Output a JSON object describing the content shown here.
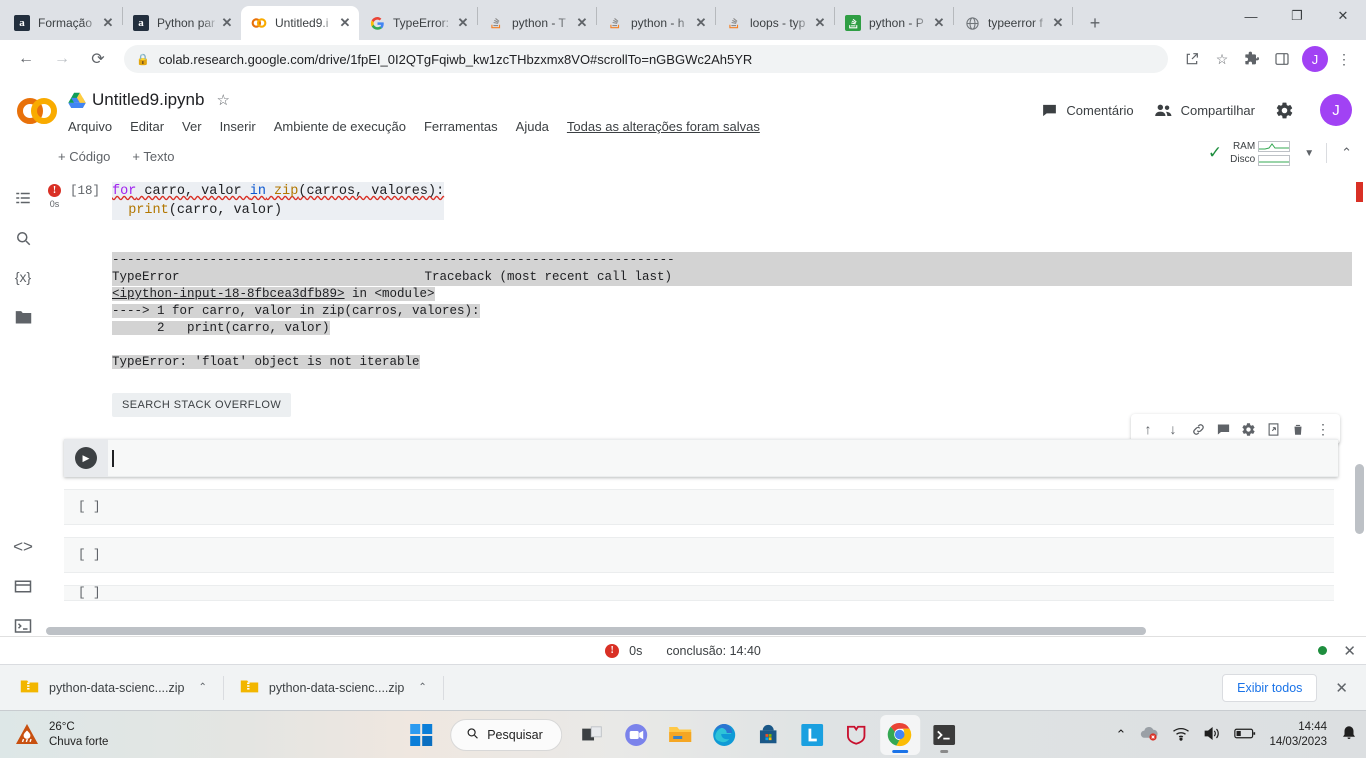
{
  "browser": {
    "tabs": [
      {
        "title": "Formação",
        "favicon": "amazon-icon",
        "active": false
      },
      {
        "title": "Python par",
        "favicon": "amazon-icon",
        "active": false
      },
      {
        "title": "Untitled9.i",
        "favicon": "colab-icon",
        "active": true
      },
      {
        "title": "TypeError:",
        "favicon": "google-icon",
        "active": false
      },
      {
        "title": "python - T",
        "favicon": "stackoverflow-icon",
        "active": false
      },
      {
        "title": "python - h",
        "favicon": "stackoverflow-icon",
        "active": false
      },
      {
        "title": "loops - typ",
        "favicon": "stackoverflow-icon",
        "active": false
      },
      {
        "title": "python - P",
        "favicon": "stackoverflow-green-icon",
        "active": false
      },
      {
        "title": "typeerror f",
        "favicon": "globe-icon",
        "active": false
      }
    ],
    "new_tab_label": "+",
    "window_controls": {
      "minimize": "—",
      "maximize": "❐",
      "close": "✕"
    },
    "nav": {
      "back": "←",
      "forward": "→",
      "reload": "⟳"
    },
    "url": "colab.research.google.com/drive/1fpEI_0I2QTgFqiwb_kw1zcTHbzxmx8VO#scrollTo=nGBGWc2Ah5YR",
    "lock_icon": "lock-icon",
    "toolbar_icons": [
      "share-icon",
      "star-icon",
      "extensions-icon",
      "sidepanel-icon",
      "menu-icon"
    ],
    "profile_initial": "J"
  },
  "colab": {
    "logo": "colab-logo",
    "notebook_title": "Untitled9.ipynb",
    "drive_icon": "drive-icon",
    "star_icon": "star-icon",
    "menu": [
      "Arquivo",
      "Editar",
      "Ver",
      "Inserir",
      "Ambiente de execução",
      "Ferramentas",
      "Ajuda"
    ],
    "save_status": "Todas as alterações foram salvas",
    "comment_label": "Comentário",
    "share_label": "Compartilhar",
    "settings_icon": "gear-icon",
    "avatar_initial": "J",
    "add_code_label": "+ Código",
    "add_text_label": "+ Texto",
    "resources": {
      "ram_label": "RAM",
      "disk_label": "Disco",
      "check_icon": "check-icon",
      "caret_icon": "chevron-down-icon",
      "collapse_icon": "chevron-up-icon"
    },
    "sidebar_icons": [
      "table-of-contents-icon",
      "search-icon",
      "variables-icon",
      "files-icon",
      "code-snippets-icon",
      "commands-icon",
      "terminal-icon"
    ],
    "cell": {
      "execution_count": "[18]",
      "error_badge": "!",
      "exec_time": "0s",
      "code_line_1": "for carro, valor in zip(carros, valores):",
      "code_line_2": "  print(carro, valor)",
      "code_tokens": {
        "kw_for": "for",
        "t_carro_valor": " carro, valor ",
        "kw_in": "in",
        "t_zip": " zip",
        "t_args": "(carros, valores):",
        "l2_indent": "  ",
        "l2_print": "print",
        "l2_args": "(carro, valor)"
      },
      "output": {
        "divider": "---------------------------------------------------------------------------",
        "err_name": "TypeError",
        "traceback_label": "Traceback (most recent call last)",
        "frame_file": "<ipython-input-18-8fbcea3dfb89>",
        "frame_in": " in <module>",
        "tb_line_1": "----> 1 for carro, valor in zip(carros, valores):",
        "tb_line_2": "      2   print(carro, valor)",
        "err_message": "TypeError: 'float' object is not iterable",
        "search_button": "SEARCH STACK OVERFLOW"
      }
    },
    "cell_toolbar_icons": [
      "move-up-icon",
      "move-down-icon",
      "link-icon",
      "comment-icon",
      "settings-icon",
      "open-in-new-icon",
      "delete-icon",
      "more-options-icon"
    ],
    "active_cell": {
      "run_icon": "run-icon",
      "value": "",
      "placeholder": ""
    },
    "empty_cells": [
      "[ ]",
      "[ ]",
      "[ ]"
    ],
    "status": {
      "error_badge": "!",
      "elapsed": "0s",
      "completion": "conclusão: 14:40",
      "connected_icon": "connected-dot",
      "close_icon": "close-icon"
    }
  },
  "downloads": {
    "items": [
      {
        "name": "python-data-scienc....zip",
        "icon": "zip-icon",
        "caret": "chevron-up-icon"
      },
      {
        "name": "python-data-scienc....zip",
        "icon": "zip-icon",
        "caret": "chevron-up-icon"
      }
    ],
    "show_all_label": "Exibir todos",
    "close_icon": "close-icon"
  },
  "taskbar": {
    "weather": {
      "temperature": "26°C",
      "condition": "Chuva forte",
      "icon": "rain-icon"
    },
    "start_icon": "windows-start-icon",
    "search_label": "Pesquisar",
    "search_icon": "search-icon",
    "apps": [
      "task-view-icon",
      "teams-icon",
      "file-explorer-icon",
      "edge-icon",
      "microsoft-store-icon",
      "linkedin-icon",
      "mcafee-icon",
      "chrome-icon",
      "terminal-icon"
    ],
    "tray": {
      "overflow_icon": "chevron-up-icon",
      "onedrive_icon": "onedrive-error-icon",
      "wifi_icon": "wifi-icon",
      "volume_icon": "volume-icon",
      "battery_icon": "battery-icon",
      "time": "14:44",
      "date": "14/03/2023",
      "notification_icon": "notifications-icon"
    }
  }
}
